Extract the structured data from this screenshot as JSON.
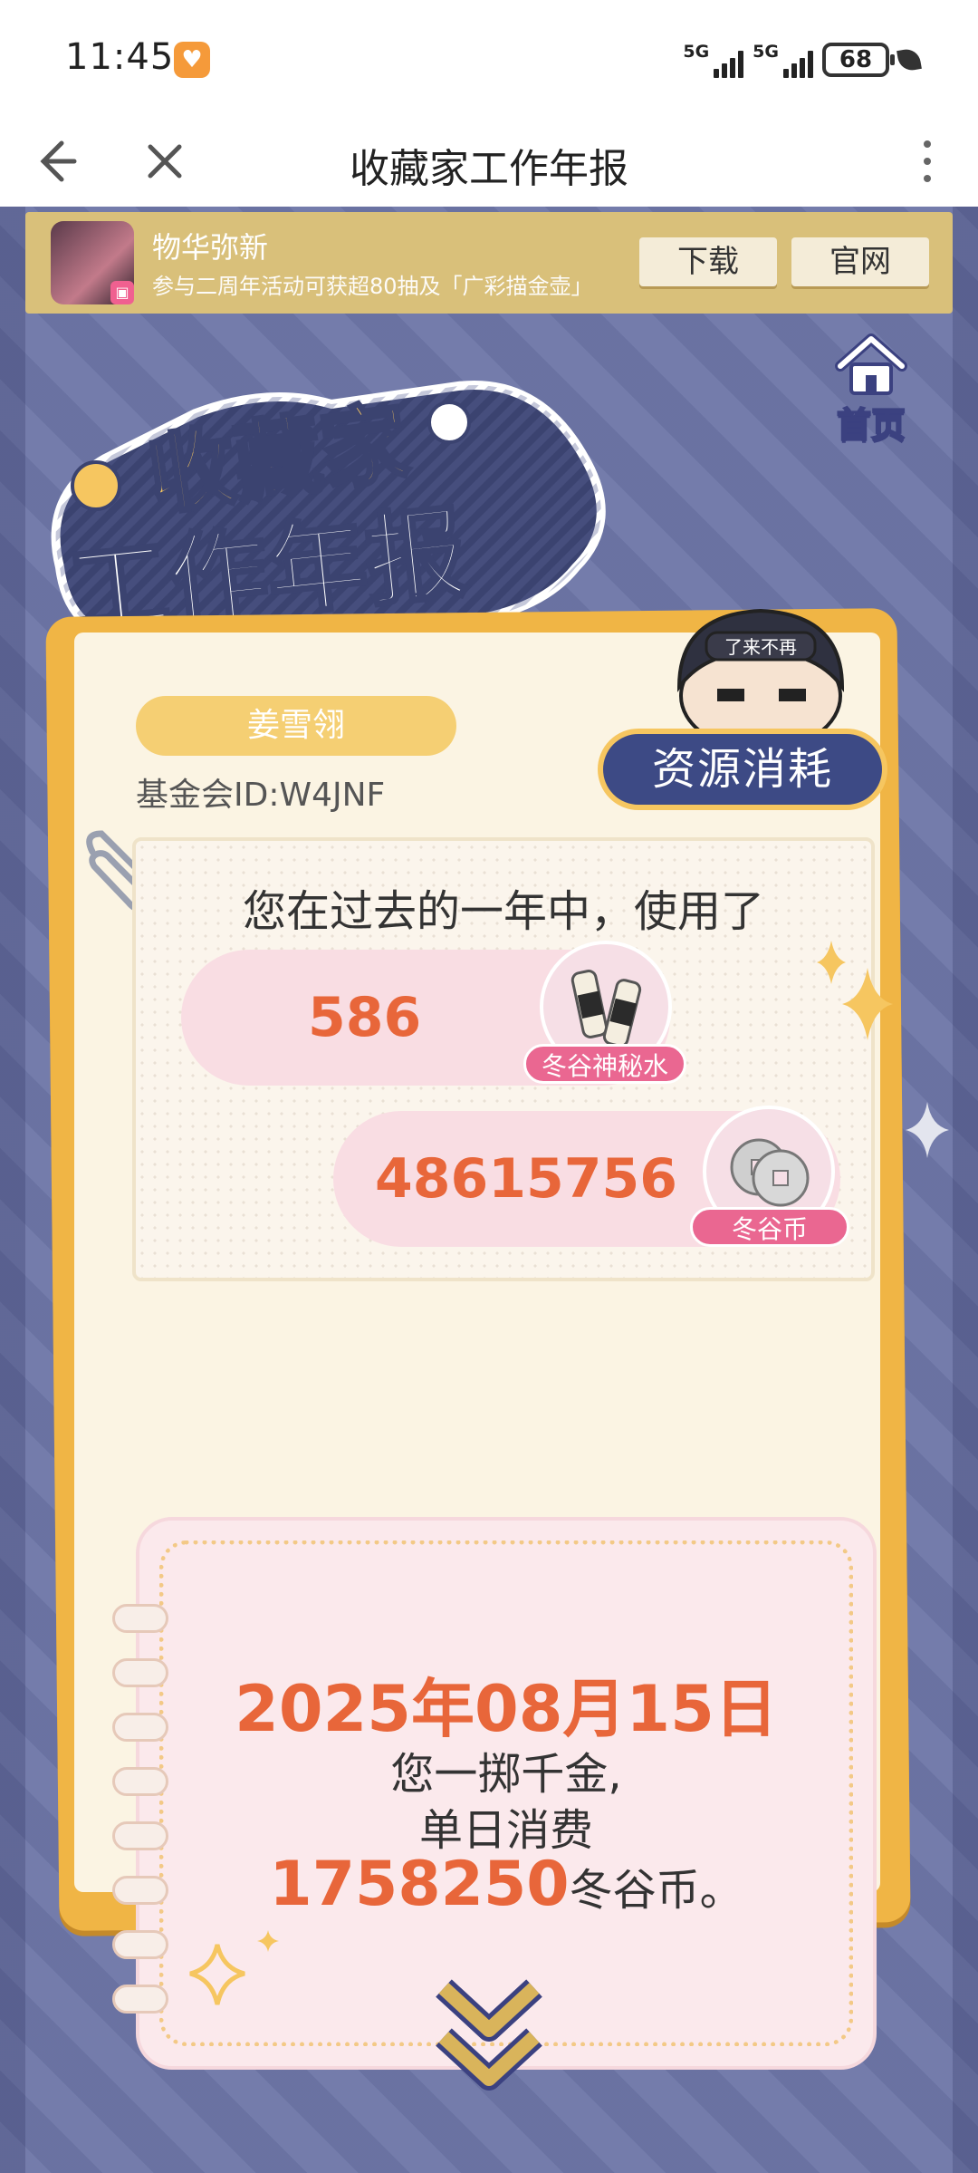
{
  "status_bar": {
    "time": "11:45",
    "network_1": "5G",
    "network_2": "5G",
    "battery": "68"
  },
  "title_bar": {
    "title": "收藏家工作年报"
  },
  "banner": {
    "name": "物华弥新",
    "description": "参与二周年活动可获超80抽及「广彩描金壶」",
    "download_label": "下载",
    "official_label": "官网"
  },
  "home": {
    "label": "首页"
  },
  "logo": {
    "line1": "收藏家",
    "line2": "工作年报"
  },
  "profile": {
    "name": "姜雪翎",
    "fund_id": "基金会ID:W4JNF"
  },
  "section": {
    "tag": "资源消耗",
    "mascot_text": "了来不再"
  },
  "usage": {
    "heading": "您在过去的一年中，使用了",
    "items": [
      {
        "value": "586",
        "label": "冬谷神秘水"
      },
      {
        "value": "48615756",
        "label": "冬谷币"
      }
    ]
  },
  "highlight": {
    "date": "2025年08月15日",
    "line1": "您一掷千金,",
    "line2": "单日消费",
    "amount": "1758250",
    "unit": "冬谷币。"
  },
  "colors": {
    "background": "#6e77a8",
    "card": "#f0b545",
    "accent_orange": "#e8663a",
    "pink_label": "#ea6791",
    "tag_navy": "#3d4a85"
  }
}
